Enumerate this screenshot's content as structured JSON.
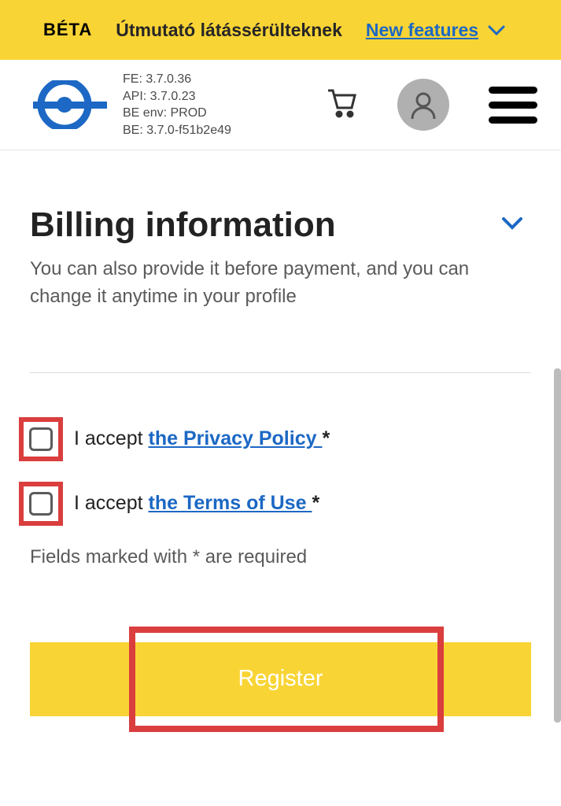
{
  "banner": {
    "beta": "BÉTA",
    "text": "Útmutató látássérülteknek",
    "link": "New features"
  },
  "version": {
    "fe": "FE: 3.7.0.36",
    "api": "API: 3.7.0.23",
    "env": "BE env: PROD",
    "be": "BE: 3.7.0-f51b2e49"
  },
  "billing": {
    "heading": "Billing information",
    "subtext": "You can also provide it before payment, and you can change it anytime in your profile"
  },
  "checks": {
    "accept_prefix": "I accept ",
    "privacy_link": "the Privacy Policy ",
    "terms_link": "the Terms of Use ",
    "asterisk": "*"
  },
  "required_note": "Fields marked with * are required",
  "register_label": "Register"
}
